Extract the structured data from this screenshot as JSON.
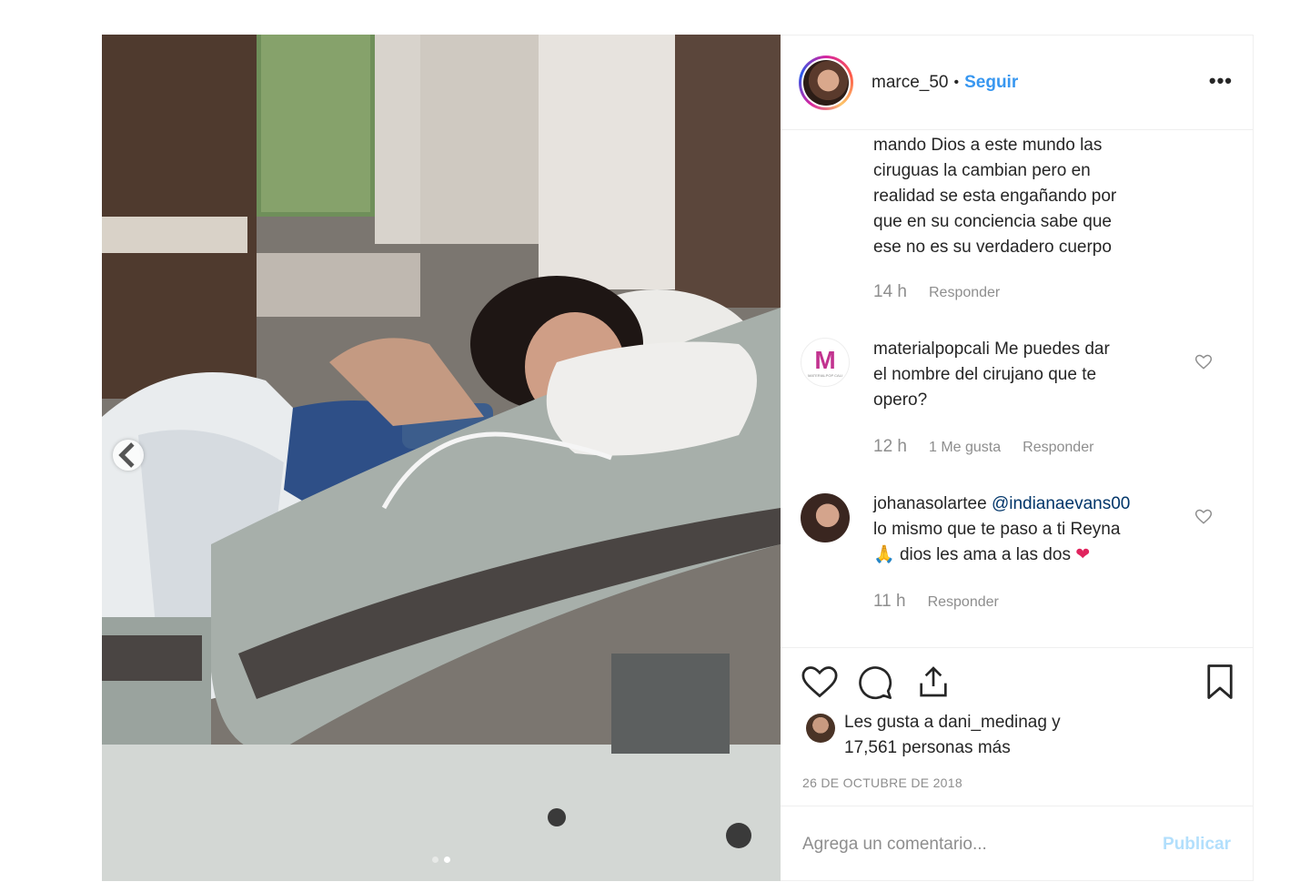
{
  "post": {
    "username": "marce_50",
    "bullet": "•",
    "follow_label": "Seguir",
    "more_label": "•••"
  },
  "comments": [
    {
      "username": "",
      "text_lines": [
        "mando Dios a este mundo las",
        "ciruguas la cambian pero en",
        "realidad se esta engañando por",
        "que en su conciencia sabe que",
        "ese no es su verdadero cuerpo"
      ],
      "time": "14 h",
      "likes": "",
      "reply_label": "Responder"
    },
    {
      "username": "materialpopcali",
      "text_line1": "Me puedes dar",
      "text_line2": "el nombre del cirujano que te",
      "text_line3": "opero?",
      "time": "12 h",
      "likes": "1 Me gusta",
      "reply_label": "Responder",
      "avatar_letter": "M",
      "avatar_caption": "MATERIALPOP CALI"
    },
    {
      "username": "johanasolartee",
      "mention": "@indianaevans00",
      "text_line2": "lo mismo que te paso a ti Reyna",
      "text_line3": "dios les ama a las dos",
      "prayer_emoji": "🙏",
      "heart_emoji": "❤",
      "time": "11 h",
      "reply_label": "Responder"
    }
  ],
  "likes": {
    "line1": "Les gusta a dani_medinag y",
    "line2": "17,561 personas más"
  },
  "date": "26 DE OCTUBRE DE 2018",
  "comment_box": {
    "placeholder": "Agrega un comentario...",
    "publish_label": "Publicar"
  },
  "colors": {
    "accent": "#3897f0",
    "mention": "#003569",
    "muted": "#8e8e8e",
    "publish_disabled": "#b2dffc",
    "emoji_heart": "#e0245e"
  },
  "carousel": {
    "slide": 2,
    "total": 2
  }
}
